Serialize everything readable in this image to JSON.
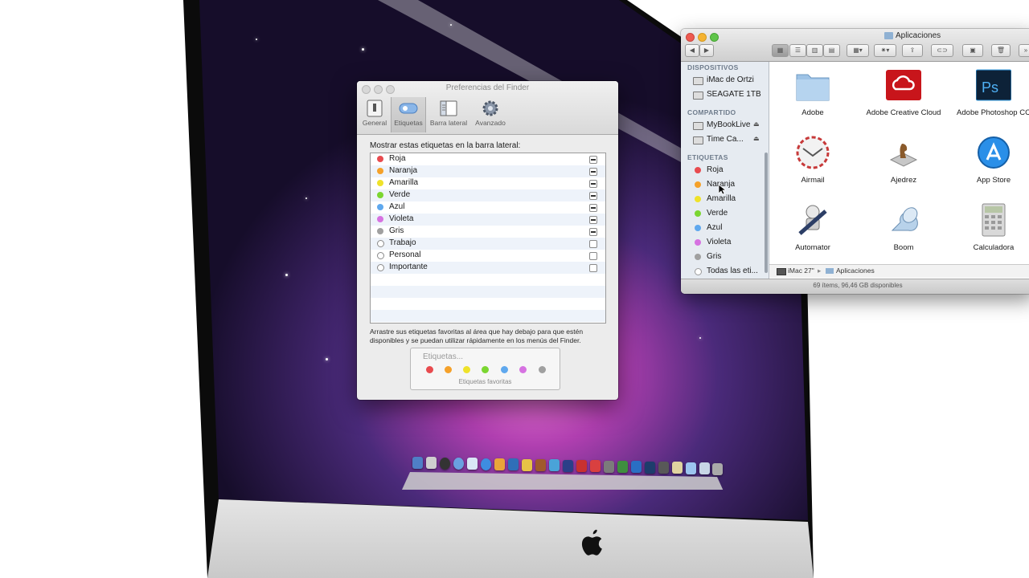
{
  "prefs_window": {
    "title": "Preferencias del Finder",
    "tabs": [
      {
        "label": "General",
        "icon": "general-icon",
        "selected": false
      },
      {
        "label": "Etiquetas",
        "icon": "tag-icon",
        "selected": true
      },
      {
        "label": "Barra lateral",
        "icon": "sidebar-icon",
        "selected": false
      },
      {
        "label": "Avanzado",
        "icon": "gear-icon",
        "selected": false
      }
    ],
    "heading": "Mostrar estas etiquetas en la barra lateral:",
    "tags": [
      {
        "name": "Roja",
        "color": "#e84b4f",
        "checked": true
      },
      {
        "name": "Naranja",
        "color": "#f5a12a",
        "checked": true
      },
      {
        "name": "Amarilla",
        "color": "#efe22a",
        "checked": true
      },
      {
        "name": "Verde",
        "color": "#7bd631",
        "checked": true
      },
      {
        "name": "Azul",
        "color": "#5fa8ee",
        "checked": true
      },
      {
        "name": "Violeta",
        "color": "#d672e1",
        "checked": true
      },
      {
        "name": "Gris",
        "color": "#a0a0a0",
        "checked": true
      },
      {
        "name": "Trabajo",
        "color": null,
        "checked": false
      },
      {
        "name": "Personal",
        "color": null,
        "checked": false
      },
      {
        "name": "Importante",
        "color": null,
        "checked": false
      }
    ],
    "help_text": "Arrastre sus etiquetas favoritas al área que hay debajo para que estén disponibles y se puedan utilizar rápidamente en los menús del Finder.",
    "favorites_placeholder": "Etiquetas...",
    "favorites_colors": [
      "#e84b4f",
      "#f5a12a",
      "#efe22a",
      "#7bd631",
      "#5fa8ee",
      "#d672e1",
      "#a0a0a0"
    ],
    "favorites_caption": "Etiquetas favoritas"
  },
  "finder_window": {
    "title": "Aplicaciones",
    "sidebar": {
      "devices_header": "DISPOSITIVOS",
      "devices": [
        {
          "label": "iMac de Ortzi",
          "icon": "computer-icon"
        },
        {
          "label": "SEAGATE 1TB",
          "icon": "drive-icon"
        }
      ],
      "shared_header": "COMPARTIDO",
      "shared": [
        {
          "label": "MyBookLive",
          "icon": "network-drive-icon",
          "eject": "⏏"
        },
        {
          "label": "Time Ca...",
          "icon": "time-capsule-icon",
          "eject": "⏏"
        }
      ],
      "tags_header": "ETIQUETAS",
      "tags": [
        {
          "label": "Roja",
          "color": "#e84b4f"
        },
        {
          "label": "Naranja",
          "color": "#f5a12a"
        },
        {
          "label": "Amarilla",
          "color": "#efe22a"
        },
        {
          "label": "Verde",
          "color": "#7bd631"
        },
        {
          "label": "Azul",
          "color": "#5fa8ee"
        },
        {
          "label": "Violeta",
          "color": "#d672e1"
        },
        {
          "label": "Gris",
          "color": "#a0a0a0"
        },
        {
          "label": "Todas las eti...",
          "color": "#ffffff"
        }
      ]
    },
    "apps": [
      {
        "label": "Adobe",
        "icon": "folder-icon"
      },
      {
        "label": "Adobe Creative Cloud",
        "icon": "creative-cloud-icon"
      },
      {
        "label": "Adobe Photoshop CC",
        "icon": "photoshop-icon"
      },
      {
        "label": "Airmail",
        "icon": "airmail-icon"
      },
      {
        "label": "Ajedrez",
        "icon": "chess-icon"
      },
      {
        "label": "App Store",
        "icon": "app-store-icon"
      },
      {
        "label": "Automator",
        "icon": "automator-icon"
      },
      {
        "label": "Boom",
        "icon": "boom-icon"
      },
      {
        "label": "Calculadora",
        "icon": "calculator-icon"
      }
    ],
    "path": {
      "computer": "iMac 27\"",
      "folder": "Aplicaciones"
    },
    "status": "69 ítems, 96,46 GB disponibles"
  },
  "photoshop_badge": "Ps",
  "colors": {
    "accent": "#5fa8ee",
    "desktop": "#2b1a4a"
  }
}
